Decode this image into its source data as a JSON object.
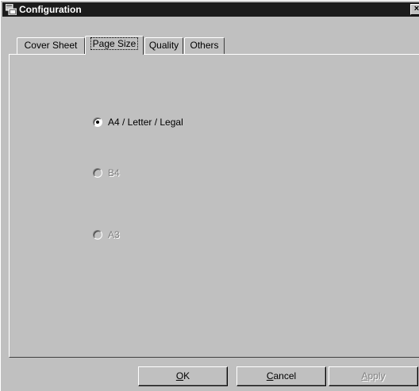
{
  "window": {
    "title": "Configuration",
    "close_label": "×"
  },
  "tabs": [
    {
      "label": "Cover Sheet",
      "active": false
    },
    {
      "label": "Page Size",
      "active": true
    },
    {
      "label": "Quality",
      "active": false
    },
    {
      "label": "Others",
      "active": false
    }
  ],
  "page_size": {
    "options": [
      {
        "label": "A4 / Letter / Legal",
        "selected": true,
        "enabled": true
      },
      {
        "label": "B4",
        "selected": false,
        "enabled": false
      },
      {
        "label": "A3",
        "selected": false,
        "enabled": false
      }
    ]
  },
  "buttons": {
    "ok": {
      "mnemonic": "O",
      "rest": "K",
      "enabled": true
    },
    "cancel": {
      "mnemonic": "C",
      "rest": "ancel",
      "enabled": true
    },
    "apply": {
      "mnemonic": "A",
      "rest": "pply",
      "enabled": false
    }
  }
}
